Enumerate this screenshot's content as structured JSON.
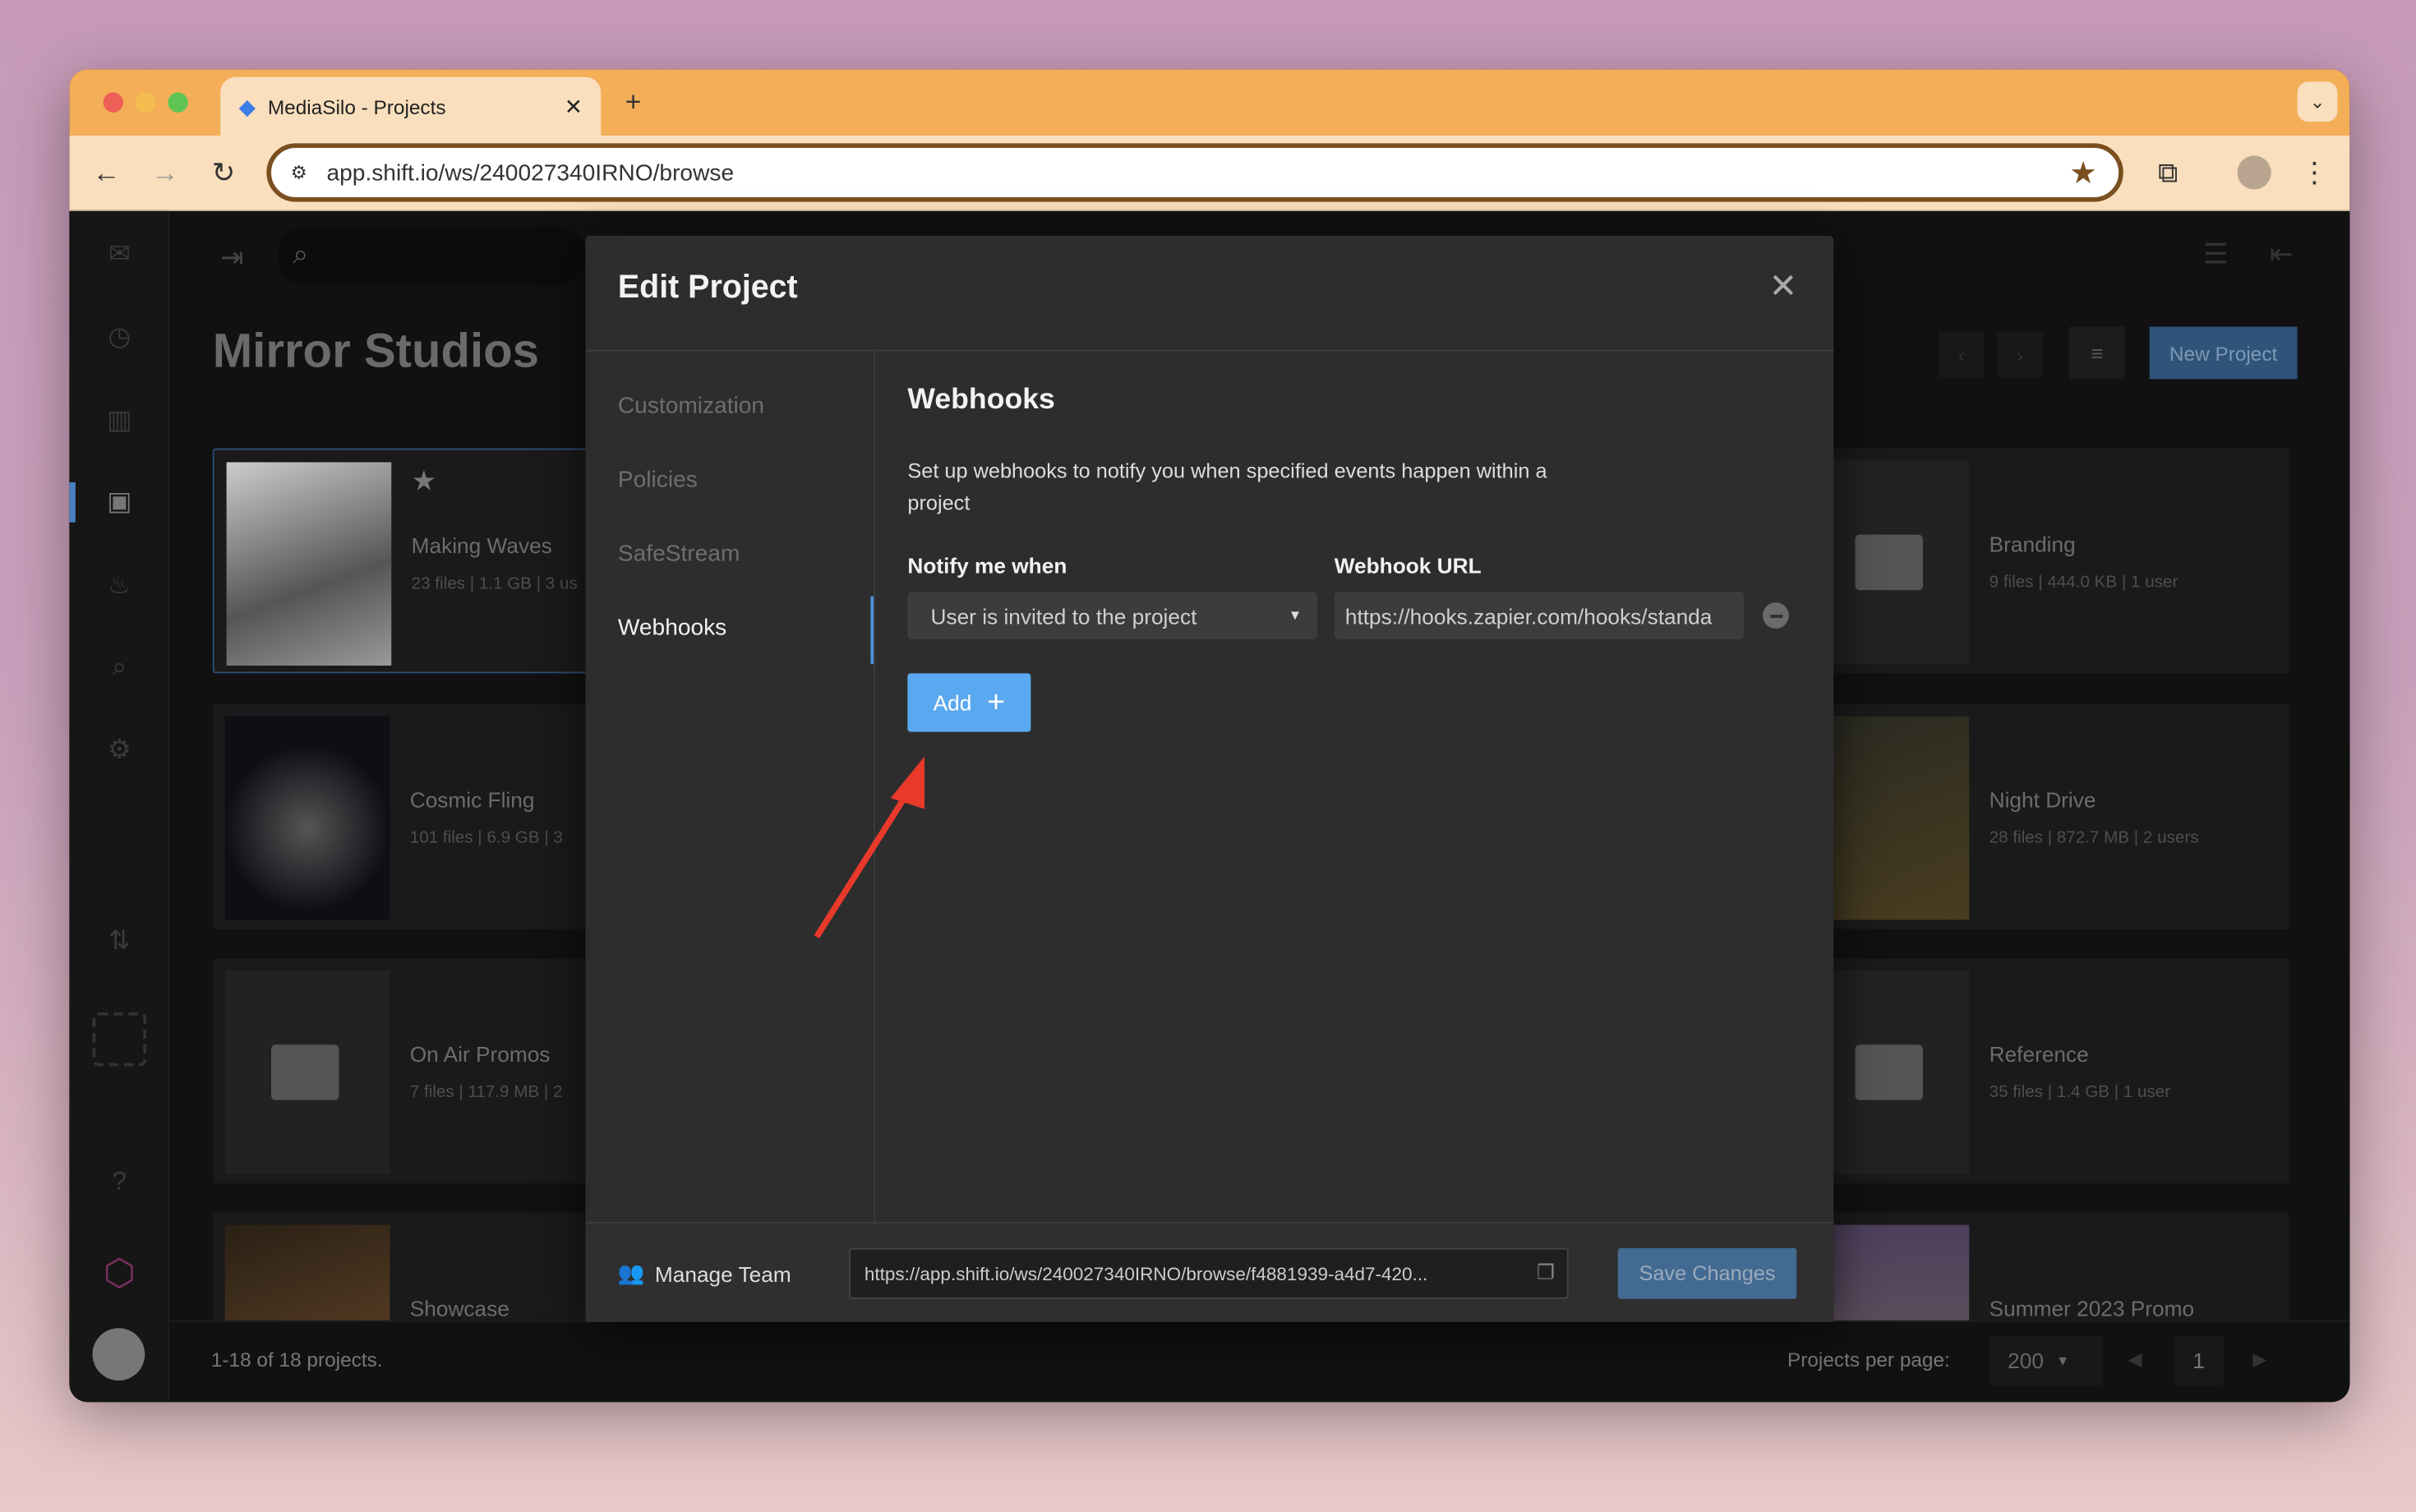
{
  "browser": {
    "tab_title": "MediaSilo - Projects",
    "url": "app.shift.io/ws/240027340IRNO/browse"
  },
  "app": {
    "workspace_title": "Mirror Studios",
    "new_project_label": "New Project",
    "pagination_summary": "1-18 of 18 projects.",
    "per_page_label": "Projects per page:",
    "per_page_value": "200",
    "current_page": "1",
    "projects": [
      {
        "title": "Making Waves",
        "meta": "23 files | 1.1 GB | 3 us"
      },
      {
        "title": "Branding",
        "meta": "9 files | 444.0 KB | 1 user"
      },
      {
        "title": "Cosmic Fling",
        "meta": "101 files | 6.9 GB | 3"
      },
      {
        "title": "Night Drive",
        "meta": "28 files | 872.7 MB | 2 users"
      },
      {
        "title": "On Air Promos",
        "meta": "7 files | 117.9 MB | 2"
      },
      {
        "title": "Reference",
        "meta": "35 files | 1.4 GB | 1 user"
      },
      {
        "title": "Showcase",
        "meta": ""
      },
      {
        "title": "Summer 2023 Promo",
        "meta": ""
      }
    ]
  },
  "modal": {
    "title": "Edit Project",
    "nav": [
      "Customization",
      "Policies",
      "SafeStream",
      "Webhooks"
    ],
    "section_title": "Webhooks",
    "description": "Set up webhooks to notify you when specified events happen within a project",
    "notify_label": "Notify me when",
    "notify_value": "User is invited to the project",
    "url_label": "Webhook URL",
    "url_value": "https://hooks.zapier.com/hooks/standa",
    "add_label": "Add",
    "manage_team_label": "Manage Team",
    "share_url": "https://app.shift.io/ws/240027340IRNO/browse/f4881939-a4d7-420...",
    "save_label": "Save Changes"
  },
  "colors": {
    "accent": "#5aa9f0",
    "save": "#436a92",
    "annotation_arrow": "#e8392b",
    "tabbar": "#f3ae57"
  }
}
